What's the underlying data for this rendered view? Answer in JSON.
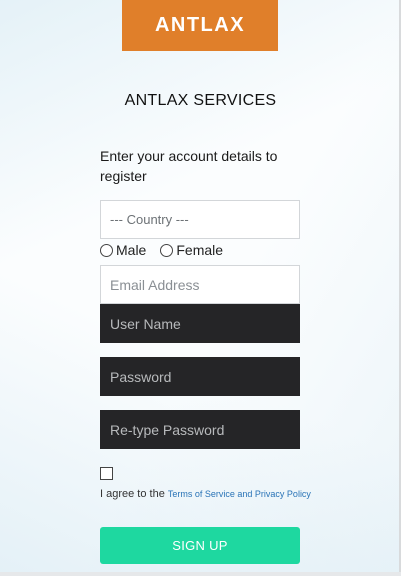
{
  "logo": {
    "text": "ANTLAX",
    "color": "#e07f2a"
  },
  "title": "ANTLAX SERVICES",
  "intro": "Enter your account details to register",
  "form": {
    "country_placeholder": "--- Country ---",
    "gender": {
      "male_label": "Male",
      "female_label": "Female"
    },
    "email_placeholder": "Email Address",
    "username_placeholder": "User Name",
    "password_placeholder": "Password",
    "retype_password_placeholder": "Re-type Password",
    "agree_prefix": "I agree to the",
    "agree_link": "Terms of Service and Privacy Policy",
    "submit_label": "SIGN UP"
  },
  "colors": {
    "accent": "#1ed8a0",
    "dark_field": "#252527",
    "link": "#2a74b7"
  }
}
